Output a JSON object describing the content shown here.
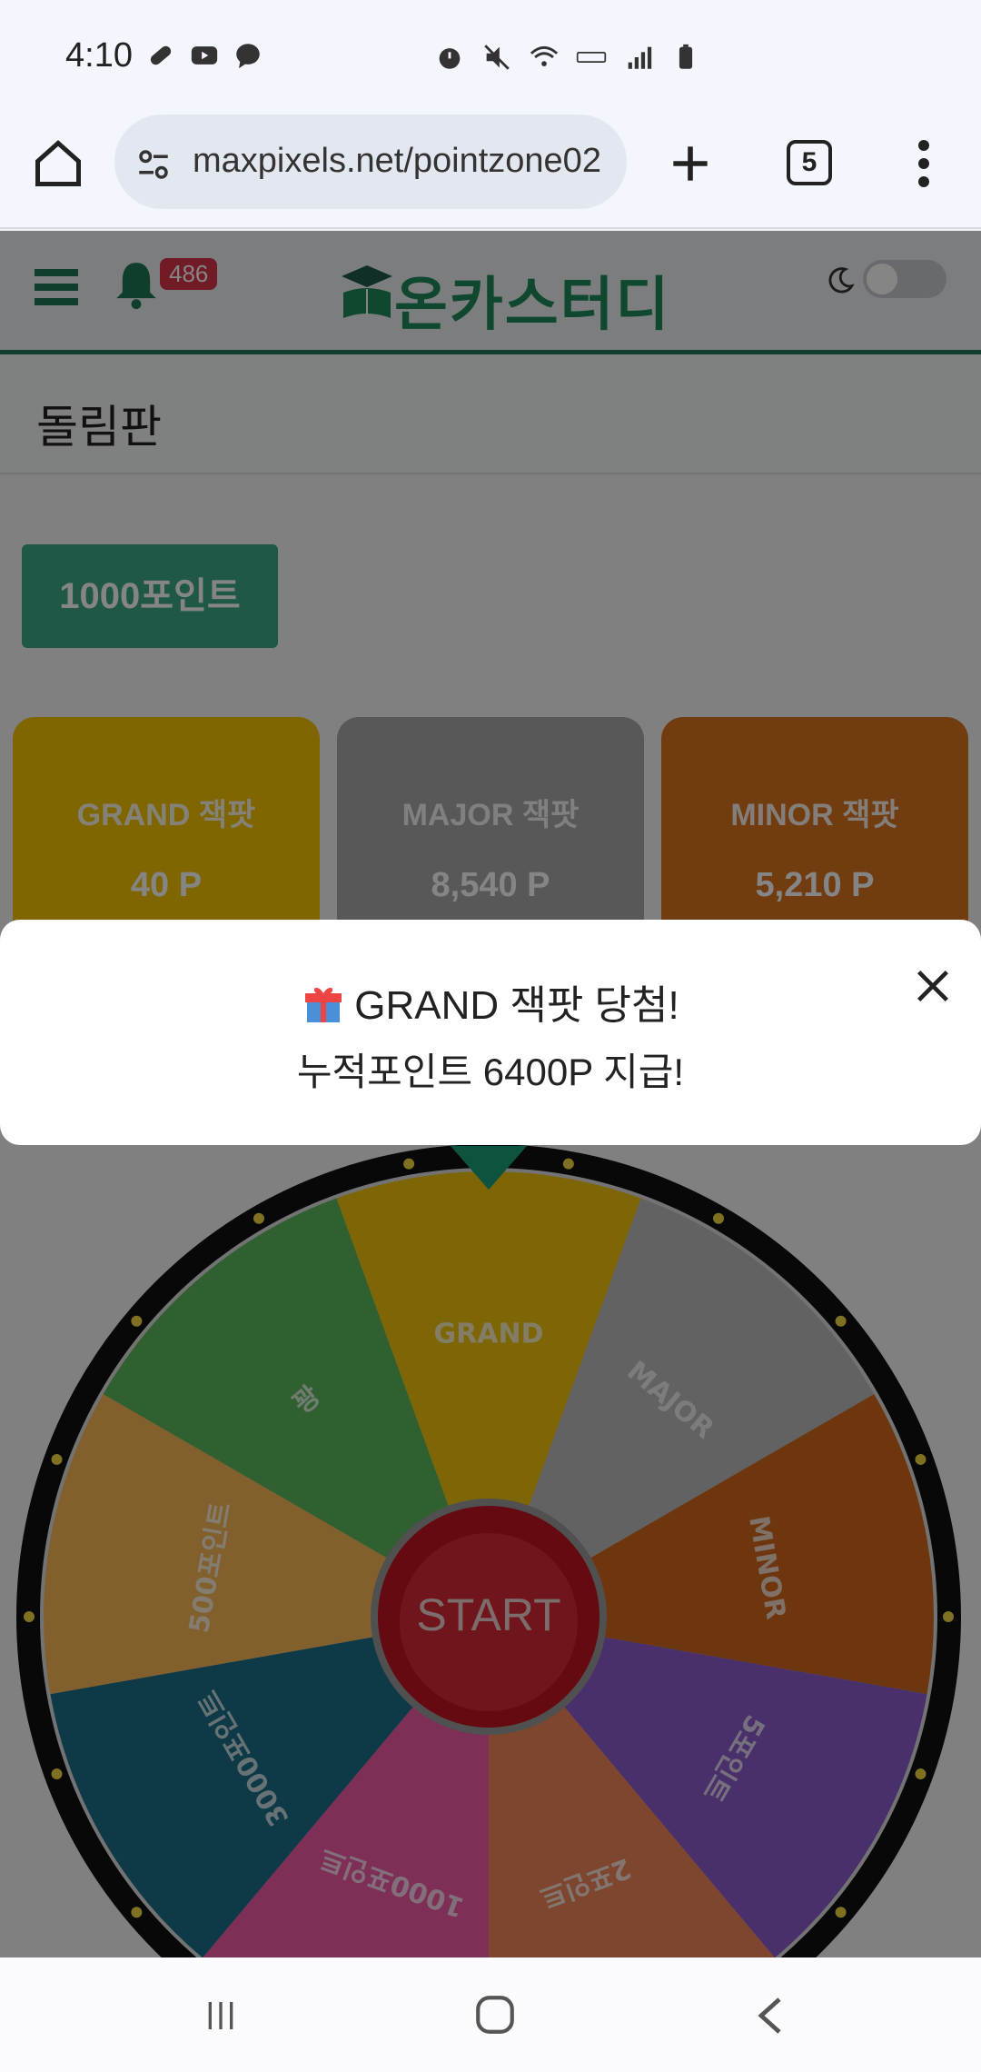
{
  "status_bar": {
    "time": "4:10"
  },
  "browser": {
    "url": "maxpixels.net/pointzone02",
    "tab_count": "5"
  },
  "header": {
    "notification_count": "486",
    "logo_text": "온카스터디"
  },
  "page": {
    "title": "돌림판"
  },
  "points_button": "1000포인트",
  "jackpots": [
    {
      "title": "GRAND 잭팟",
      "value": "40 P",
      "color": "#f3c300"
    },
    {
      "title": "MAJOR 잭팟",
      "value": "8,540 P",
      "color": "#a9a9a9"
    },
    {
      "title": "MINOR 잭팟",
      "value": "5,210 P",
      "color": "#d9761f"
    }
  ],
  "wheel": {
    "start_label": "START",
    "segments": [
      {
        "label": "GRAND",
        "color": "#f1c40f"
      },
      {
        "label": "MAJOR",
        "color": "#bdbdbd"
      },
      {
        "label": "MINOR",
        "color": "#d2691e"
      },
      {
        "label": "5포인트",
        "color": "#8e5ccc"
      },
      {
        "label": "2포인트",
        "color": "#f2845a"
      },
      {
        "label": "1000포인트",
        "color": "#ef5aa5"
      },
      {
        "label": "3000포인트",
        "color": "#1b6f88"
      },
      {
        "label": "500포인트",
        "color": "#f7b858"
      },
      {
        "label": "꽝",
        "color": "#5cb85c"
      }
    ]
  },
  "popup": {
    "line1": "GRAND 잭팟 당첨!",
    "line2": "누적포인트 6400P 지급!"
  }
}
